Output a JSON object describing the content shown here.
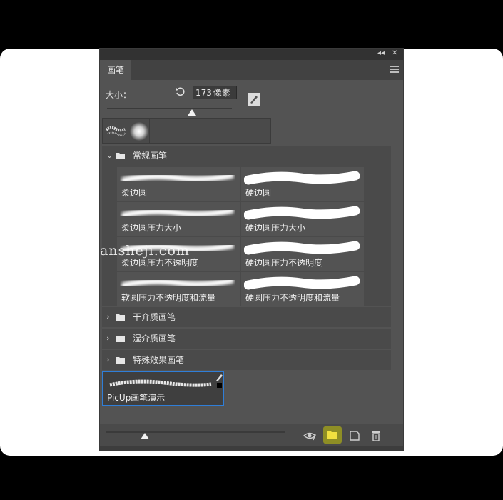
{
  "panel": {
    "tab_label": "画笔",
    "collapse_glyph": "◂◂",
    "close_glyph": "✕",
    "size_label": "大小：",
    "size_value": "173",
    "size_unit": "像素",
    "size_slider_fraction": 0.68,
    "preview_slider_fraction": 0.22
  },
  "groups": {
    "expanded": {
      "label": "常规画笔",
      "chevron": "⌄"
    },
    "collapsed": [
      {
        "label": "干介质画笔",
        "chevron": "›"
      },
      {
        "label": "湿介质画笔",
        "chevron": "›"
      },
      {
        "label": "特殊效果画笔",
        "chevron": "›"
      }
    ]
  },
  "brushes": [
    {
      "label": "柔边圆",
      "style": "soft"
    },
    {
      "label": "硬边圆",
      "style": "hard"
    },
    {
      "label": "柔边圆压力大小",
      "style": "soft"
    },
    {
      "label": "硬边圆压力大小",
      "style": "hard"
    },
    {
      "label": "柔边圆压力不透明度",
      "style": "soft"
    },
    {
      "label": "硬边圆压力不透明度",
      "style": "hard"
    },
    {
      "label": "软圆压力不透明度和流量",
      "style": "soft"
    },
    {
      "label": "硬圆压力不透明度和流量",
      "style": "hard"
    }
  ],
  "custom_brush": {
    "label": "PicUp画笔演示"
  },
  "icons": {
    "reset": "reset-icon",
    "brush_settings": "brush-settings-icon",
    "visibility": "eye-icon",
    "new_group": "folder-icon",
    "new_brush": "new-brush-icon",
    "delete": "trash-icon"
  },
  "colors": {
    "panel_bg": "#535353",
    "selection": "#2f7ed8",
    "highlight": "#8e8e25"
  },
  "watermark": "ansheji.com"
}
